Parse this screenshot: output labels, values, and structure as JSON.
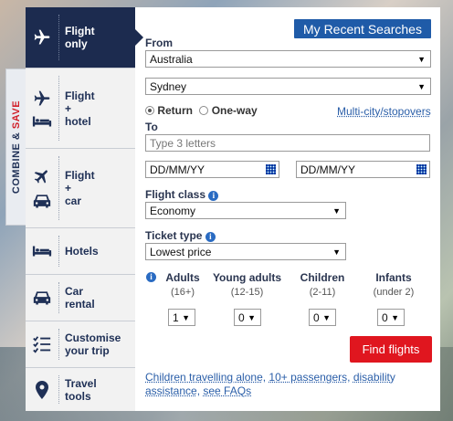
{
  "combine_save": {
    "part1": "COMBINE &",
    "part2": "SAVE"
  },
  "nav": [
    {
      "label": "Flight\nonly",
      "icons": [
        "plane-icon"
      ],
      "active": true
    },
    {
      "label": "Flight\n+\nhotel",
      "icons": [
        "plane-icon",
        "bed-icon"
      ]
    },
    {
      "label": "Flight\n+\ncar",
      "icons": [
        "plane-icon",
        "car-icon"
      ]
    },
    {
      "label": "Hotels",
      "icons": [
        "bed-icon"
      ]
    },
    {
      "label": "Car\nrental",
      "icons": [
        "car-icon"
      ]
    },
    {
      "label": "Customise\nyour trip",
      "icons": [
        "checklist-icon"
      ]
    },
    {
      "label": "Travel\ntools",
      "icons": [
        "location-pin-icon"
      ]
    }
  ],
  "panel": {
    "recent_searches": "My Recent Searches",
    "from_label": "From",
    "from_country": "Australia",
    "from_city": "Sydney",
    "trip_return": "Return",
    "trip_oneway": "One-way",
    "multicity": "Multi-city/stopovers",
    "to_label": "To",
    "to_placeholder": "Type 3 letters",
    "depart_date_placeholder": "DD/MM/YY",
    "return_date_placeholder": "DD/MM/YY",
    "class_label": "Flight class",
    "class_value": "Economy",
    "ticket_label": "Ticket type",
    "ticket_value": "Lowest price",
    "passengers": [
      {
        "label": "Adults",
        "age": "(16+)",
        "value": "1"
      },
      {
        "label": "Young adults",
        "age": "(12-15)",
        "value": "0"
      },
      {
        "label": "Children",
        "age": "(2-11)",
        "value": "0"
      },
      {
        "label": "Infants",
        "age": "(under 2)",
        "value": "0"
      }
    ],
    "find_button": "Find flights",
    "footer_links": [
      {
        "text": "Children travelling alone"
      },
      {
        "text": "10+ passengers"
      },
      {
        "text": "disability assistance"
      },
      {
        "text": "see FAQs"
      }
    ]
  },
  "colors": {
    "nav_active": "#1c2b4f",
    "recent_button": "#1f5ba8",
    "find_button": "#e0161f",
    "combine_red": "#d1202a",
    "link": "#2a5ea8"
  }
}
